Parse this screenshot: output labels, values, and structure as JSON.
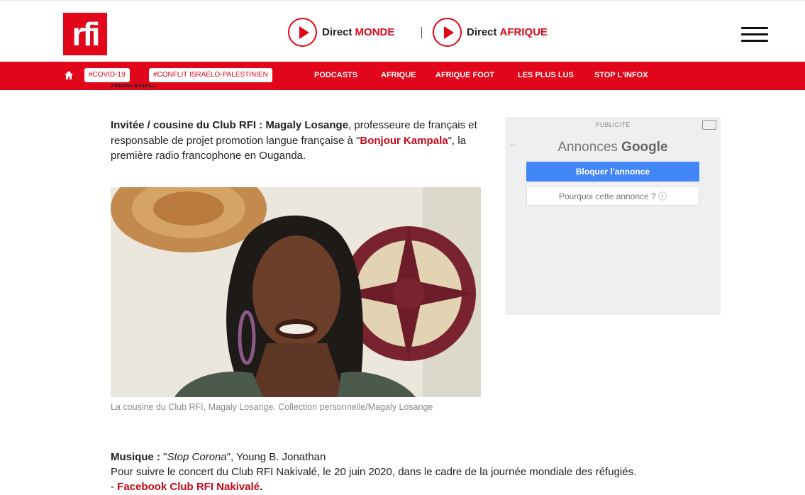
{
  "header": {
    "logo_text": "rfi",
    "live_monde": {
      "prefix": "Direct",
      "name": "MONDE"
    },
    "live_afrique": {
      "prefix": "Direct",
      "name": "AFRIQUE"
    },
    "separator": "|"
  },
  "nav": {
    "tags": [
      "#COVID-19",
      "#CONFLIT ISRAÉLO-PALESTINIEN"
    ],
    "links": [
      "PODCASTS",
      "AFRIQUE",
      "AFRIQUE FOOT",
      "LES PLUS LUS",
      "STOP L'INFOX"
    ]
  },
  "article": {
    "cut_heading": "Nakivalé.",
    "guest_label": "Invitée / cousine du Club RFI : Magaly Losange",
    "guest_desc": ", professeure de français et responsable de projet promotion langue française à \"",
    "guest_link": "Bonjour Kampala",
    "guest_tail": "\", la première radio francophone en Ouganda.",
    "caption": "La cousine du Club RFI, Magaly Losange. Collection personnelle/Magaly Losange",
    "music_label": "Musique :",
    "music_quote_open": " \"",
    "music_title": "Stop Corona",
    "music_rest": "\", Young B. Jonathan",
    "concert_line": "Pour suivre le concert du Club RFI Nakivalé, le 20 juin 2020, dans le cadre de la journée mondiale des réfugiés.",
    "fb_prefix": "- ",
    "fb_link": "Facebook Club RFI Nakivalé",
    "fb_suffix": "."
  },
  "ad": {
    "label": "PUBLICITÉ",
    "brand_prefix": "Annonces",
    "brand_name": "Google",
    "block_label": "Bloquer l'annonce",
    "why_label": "Pourquoi cette annonce ? ⓘ"
  },
  "colors": {
    "brand_red": "#e2061a",
    "link_red": "#c4081a",
    "google_blue": "#4285f4"
  }
}
